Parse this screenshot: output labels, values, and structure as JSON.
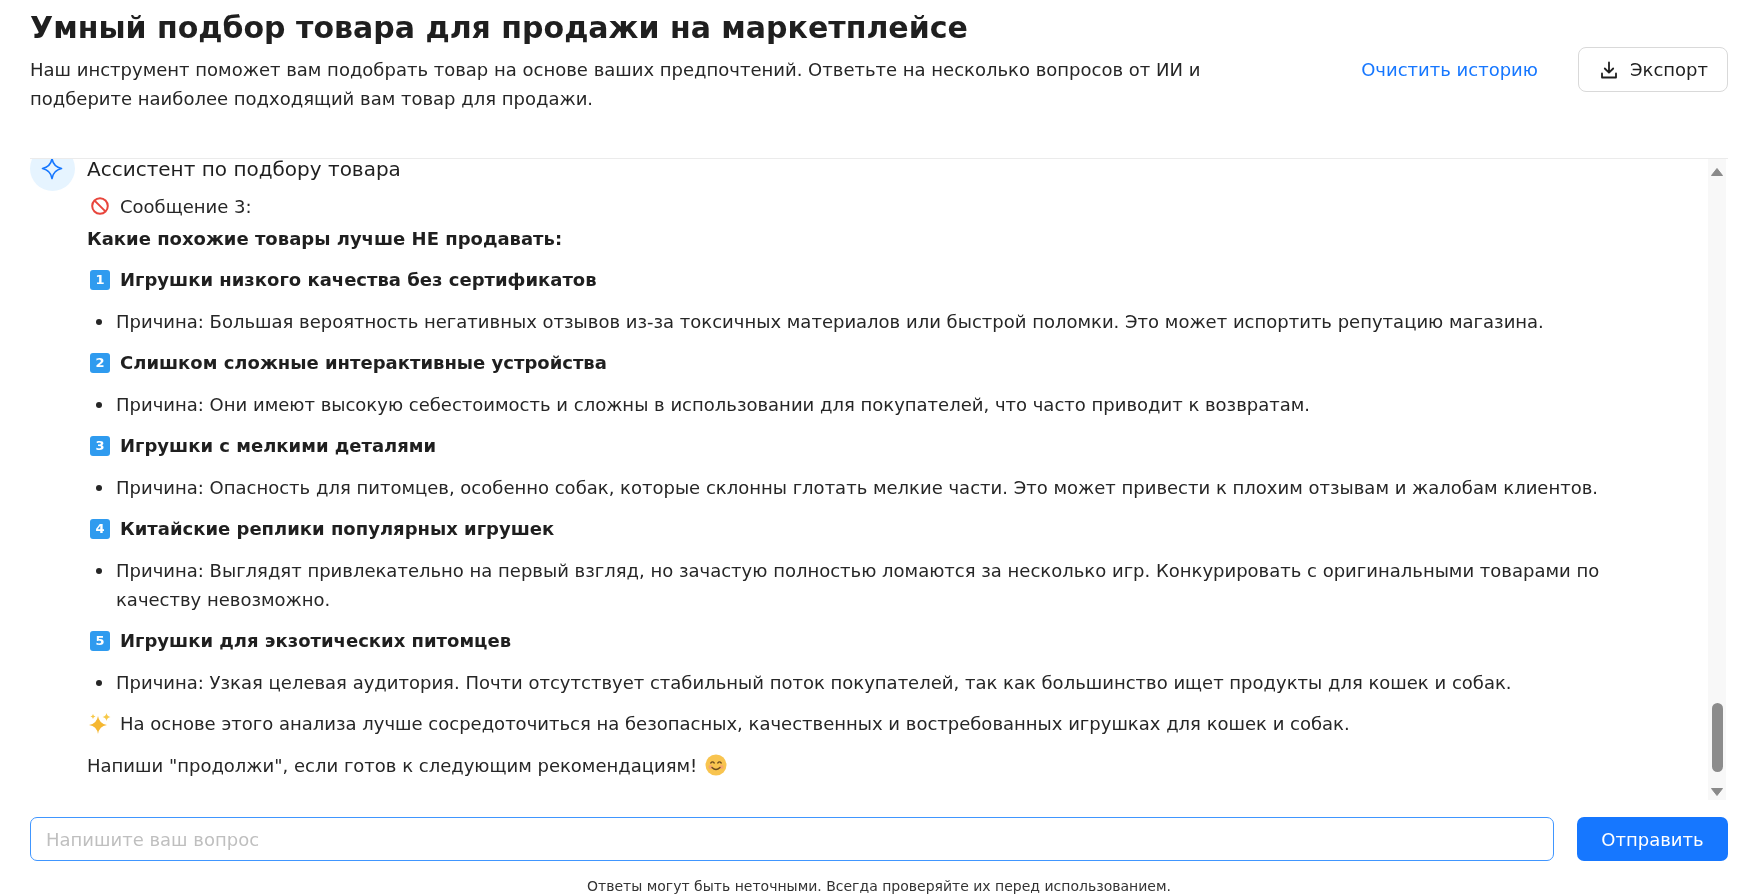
{
  "header": {
    "title": "Умный подбор товара для продажи на маркетплейсе",
    "description": "Наш инструмент поможет вам подобрать товар на основе ваших предпочтений. Ответьте на несколько вопросов от ИИ и подберите наиболее подходящий вам товар для продажи.",
    "clear_history_link": "Очистить историю",
    "export_button": "Экспорт"
  },
  "chat": {
    "assistant_name": "Ассистент по подбору товара",
    "message": {
      "label": "Сообщение 3:",
      "heading": "Какие похожие товары лучше НЕ продавать:",
      "items": [
        {
          "number": "1",
          "title": "Игрушки низкого качества без сертификатов",
          "points": [
            "Причина: Большая вероятность негативных отзывов из-за токсичных материалов или быстрой поломки. Это может испортить репутацию магазина."
          ]
        },
        {
          "number": "2",
          "title": "Слишком сложные интерактивные устройства",
          "points": [
            "Причина: Они имеют высокую себестоимость и сложны в использовании для покупателей, что часто приводит к возвратам."
          ]
        },
        {
          "number": "3",
          "title": "Игрушки с мелкими деталями",
          "points": [
            "Причина: Опасность для питомцев, особенно собак, которые склонны глотать мелкие части. Это может привести к плохим отзывам и жалобам клиентов."
          ]
        },
        {
          "number": "4",
          "title": "Китайские реплики популярных игрушек",
          "points": [
            "Причина: Выглядят привлекательно на первый взгляд, но зачастую полностью ломаются за несколько игр. Конкурировать с оригинальными товарами по качеству невозможно."
          ]
        },
        {
          "number": "5",
          "title": "Игрушки для экзотических питомцев",
          "points": [
            "Причина: Узкая целевая аудитория. Почти отсутствует стабильный поток покупателей, так как большинство ищет продукты для кошек и собак."
          ]
        }
      ],
      "conclusion": "На основе этого анализа лучше сосредоточиться на безопасных, качественных и востребованных игрушках для кошек и собак.",
      "closing": "Напиши \"продолжи\", если готов к следующим рекомендациям!"
    }
  },
  "composer": {
    "placeholder": "Напишите ваш вопрос",
    "send_button": "Отправить"
  },
  "disclaimer": "Ответы могут быть неточными. Всегда проверяйте их перед использованием."
}
